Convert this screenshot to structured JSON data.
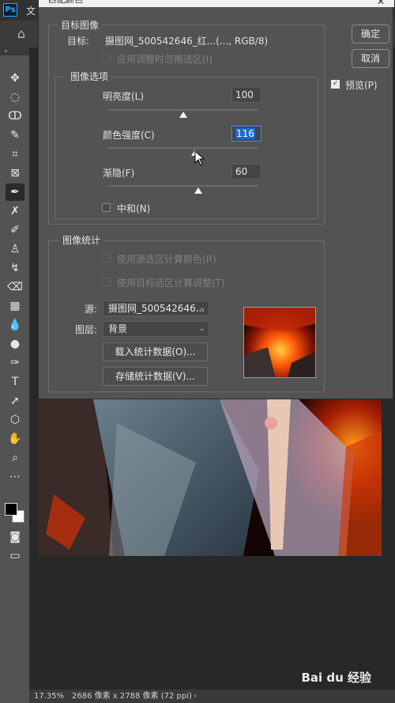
{
  "app": {
    "logo": "Ps",
    "menu_file": "文"
  },
  "dialog": {
    "title": "匹配颜色",
    "close": "✕",
    "target_group": "目标图像",
    "target_label": "目标:",
    "target_value": "摄图网_500542646_红...(..., RGB/8)",
    "ignore_selection": "应用调整时忽略选区(I)",
    "image_options_group": "图像选项",
    "luminance_label": "明亮度(L)",
    "luminance_value": "100",
    "color_intensity_label": "颜色强度(C)",
    "color_intensity_value": "116",
    "fade_label": "渐隐(F)",
    "fade_value": "60",
    "neutralize_label": "中和(N)",
    "stats_group": "图像统计",
    "use_source_selection": "使用源选区计算颜色(R)",
    "use_target_selection": "使用目标选区计算调整(T)",
    "source_label": "源:",
    "source_value": "摄图网_500542646...",
    "layer_label": "图层:",
    "layer_value": "背景",
    "load_stats": "载入统计数据(O)...",
    "save_stats": "存储统计数据(V)...",
    "ok": "确定",
    "cancel": "取消",
    "preview_label": "预览(P)"
  },
  "status": {
    "zoom": "17.35%",
    "doc": "2686 像素 x 2788 像素 (72 ppi)",
    "arrow": "›"
  },
  "sliders": {
    "luminance": 0.5,
    "color_intensity": 0.58,
    "fade": 0.6
  },
  "watermark": "Bai du 经验"
}
